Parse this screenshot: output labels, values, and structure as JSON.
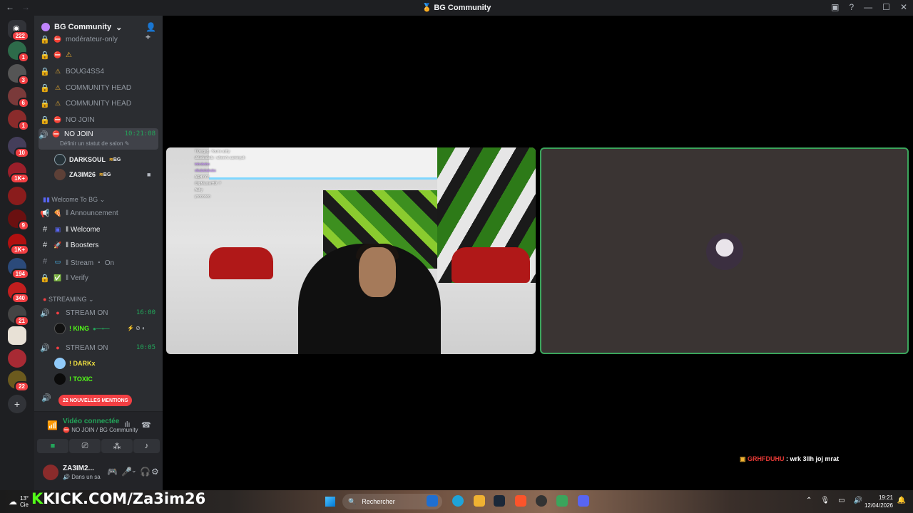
{
  "window": {
    "title": "BG Community",
    "nav_back": "←",
    "nav_forward": "→",
    "minimize": "—",
    "maximize": "☐",
    "close": "✕",
    "help": "?"
  },
  "guilds": [
    {
      "badge": "222"
    },
    {
      "badge": "1"
    },
    {
      "badge": "3"
    },
    {
      "badge": "6"
    },
    {
      "badge": "1"
    },
    {
      "badge": "10"
    },
    {
      "badge": "1K+"
    },
    {
      "badge": ""
    },
    {
      "badge": "9"
    },
    {
      "badge": "1K+"
    },
    {
      "badge": "194"
    },
    {
      "badge": "340"
    },
    {
      "badge": "21"
    },
    {
      "badge": ""
    },
    {
      "badge": ""
    },
    {
      "badge": "22"
    }
  ],
  "server": {
    "name": "BG Community",
    "chevron": "⌄"
  },
  "channels": [
    {
      "label": "modérateur-only",
      "icon": "🔒",
      "emoji": "⛔"
    },
    {
      "label": "",
      "icon": "🔒",
      "emoji": "⛔",
      "extra": "⚠"
    },
    {
      "label": "BOUG4SS4",
      "icon": "🔒",
      "emoji": "⚠"
    },
    {
      "label": "COMMUNITY HEAD",
      "icon": "🔒",
      "emoji": "⚠"
    },
    {
      "label": "COMMUNITY HEAD",
      "icon": "🔒",
      "emoji": "⚠"
    },
    {
      "label": "NO JOIN",
      "icon": "🔒",
      "emoji": "⛔"
    }
  ],
  "active_channel": {
    "label": "NO JOIN",
    "time": "10:21:08",
    "status": "Définir un statut de salon"
  },
  "voice_users": [
    {
      "name": "DARKSOUL",
      "tag": "BG"
    },
    {
      "name": "ZA3IM26",
      "tag": "BG"
    }
  ],
  "category_welcome": "Welcome To BG",
  "welcome_channels": [
    {
      "label": "‖ Announcement"
    },
    {
      "label": "‖ Welcome"
    },
    {
      "label": "‖ Boosters"
    },
    {
      "label": "‖ Stream ・ On"
    },
    {
      "label": "‖ Verify"
    }
  ],
  "category_streaming": "STREAMING",
  "stream_channels": [
    {
      "label": "STREAM ON",
      "time": "16:00",
      "users": [
        {
          "name": "! KING"
        }
      ]
    },
    {
      "label": "STREAM ON",
      "time": "10:05",
      "users": [
        {
          "name": "! DARKx"
        },
        {
          "name": "! TOXIC"
        }
      ]
    }
  ],
  "mentions_pill": "22 NOUVELLES MENTIONS",
  "voice_panel": {
    "title": "Vidéo connectée",
    "subtitle": "NO JOIN / BG Community"
  },
  "user": {
    "name": "ZA3IM2...",
    "status": "Dans un sa"
  },
  "stream_overlay_chat": [
    "TOxicjsq : You're ashy",
    "dsbsbsdsds : where's sammyah",
    "tobobobo",
    "vlksbsbsbsbs",
    "ASHYYY",
    "ClipMasterHD: ?",
    "Ashy",
    "yooooooo"
  ],
  "bottom_chat": {
    "user": "GRHFDUHU",
    "message": ": wrk 3llh joj mrat"
  },
  "taskbar": {
    "brand": "KICK.COM/Za3im26",
    "brand_k": "K",
    "search": "Rechercher",
    "time": "19:21",
    "date": "12/04/2026",
    "weather_temp": "13°",
    "weather_text": "Cie"
  },
  "colors": {
    "accent_green": "#23a55a",
    "mention_red": "#f23f43",
    "kick_green": "#53fc18"
  }
}
